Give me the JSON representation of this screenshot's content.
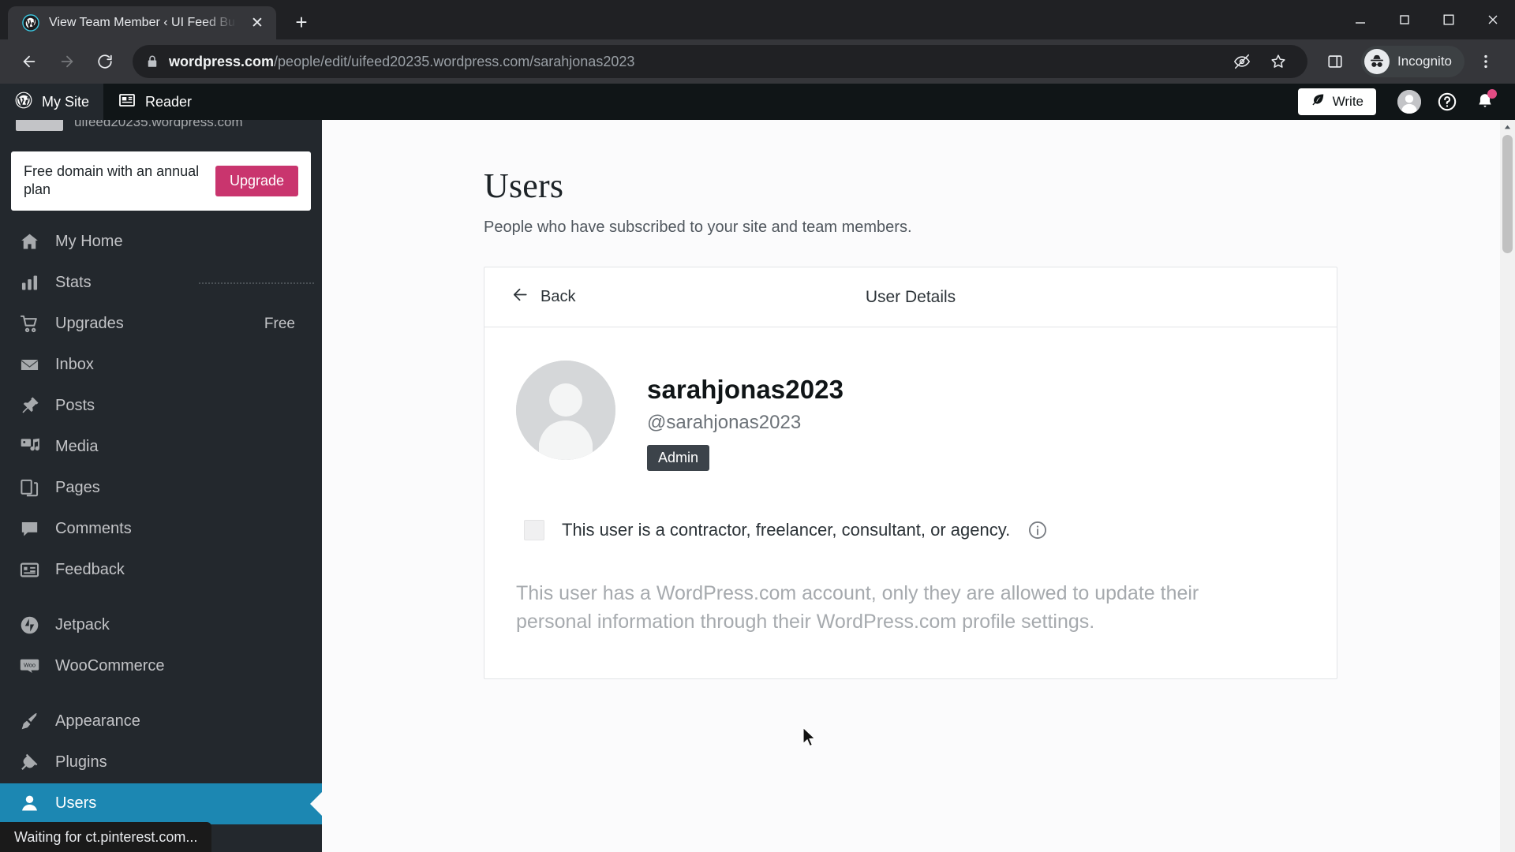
{
  "browser": {
    "tab": {
      "title": "View Team Member ‹ UI Feed Bu",
      "favicon": "wordpress-icon",
      "close": "close-icon"
    },
    "new_tab_label": "+",
    "window_controls": [
      "minimize-icon",
      "maximize-icon",
      "close-icon"
    ],
    "toolbar": {
      "back": "back-arrow-icon",
      "forward": "forward-arrow-icon",
      "reload": "reload-icon",
      "lock": "lock-icon",
      "url_domain": "wordpress.com",
      "url_path": "/people/edit/uifeed20235.wordpress.com/sarahjonas2023",
      "url_full": "wordpress.com/people/edit/uifeed20235.wordpress.com/sarahjonas2023",
      "tracking_protection": "eye-off-icon",
      "bookmark": "star-icon",
      "side_panel": "side-panel-icon",
      "incognito_label": "Incognito",
      "menu": "three-dot-menu-icon"
    }
  },
  "masterbar": {
    "my_site": "My Site",
    "reader": "Reader",
    "write": "Write",
    "avatar": "user-avatar",
    "help": "?",
    "notifications": "bell-icon"
  },
  "sidebar": {
    "site_url": "uifeed20235.wordpress.com",
    "promo": {
      "text": "Free domain with an annual plan",
      "button": "Upgrade",
      "button_color": "#C9356E"
    },
    "items": [
      {
        "label": "My Home",
        "icon": "home-icon",
        "badge": "",
        "selected": false
      },
      {
        "label": "Stats",
        "icon": "bar-chart-icon",
        "badge": "",
        "selected": false
      },
      {
        "label": "Upgrades",
        "icon": "cart-icon",
        "badge": "Free",
        "selected": false
      },
      {
        "label": "Inbox",
        "icon": "mail-icon",
        "badge": "",
        "selected": false
      },
      {
        "label": "Posts",
        "icon": "pin-icon",
        "badge": "",
        "selected": false
      },
      {
        "label": "Media",
        "icon": "media-icon",
        "badge": "",
        "selected": false
      },
      {
        "label": "Pages",
        "icon": "pages-icon",
        "badge": "",
        "selected": false
      },
      {
        "label": "Comments",
        "icon": "comment-icon",
        "badge": "",
        "selected": false
      },
      {
        "label": "Feedback",
        "icon": "feedback-icon",
        "badge": "",
        "selected": false
      },
      {
        "label": "Jetpack",
        "icon": "jetpack-icon",
        "badge": "",
        "selected": false
      },
      {
        "label": "WooCommerce",
        "icon": "woocommerce-icon",
        "badge": "",
        "selected": false
      },
      {
        "label": "Appearance",
        "icon": "brush-icon",
        "badge": "",
        "selected": false
      },
      {
        "label": "Plugins",
        "icon": "plug-icon",
        "badge": "",
        "selected": false
      },
      {
        "label": "Users",
        "icon": "user-icon",
        "badge": "",
        "selected": true
      }
    ],
    "selected_color": "#1C87B2"
  },
  "main": {
    "title": "Users",
    "subtitle": "People who have subscribed to your site and team members.",
    "card": {
      "back_label": "Back",
      "header_title": "User Details",
      "profile": {
        "name": "sarahjonas2023",
        "handle": "@sarahjonas2023",
        "role_badge": "Admin"
      },
      "contractor": {
        "checked": false,
        "label": "This user is a contractor, freelancer, consultant, or agency.",
        "info_icon": "info-icon"
      },
      "note": "This user has a WordPress.com account, only they are allowed to update their personal information through their WordPress.com profile settings."
    }
  },
  "status_bar": {
    "text": "Waiting for ct.pinterest.com..."
  }
}
